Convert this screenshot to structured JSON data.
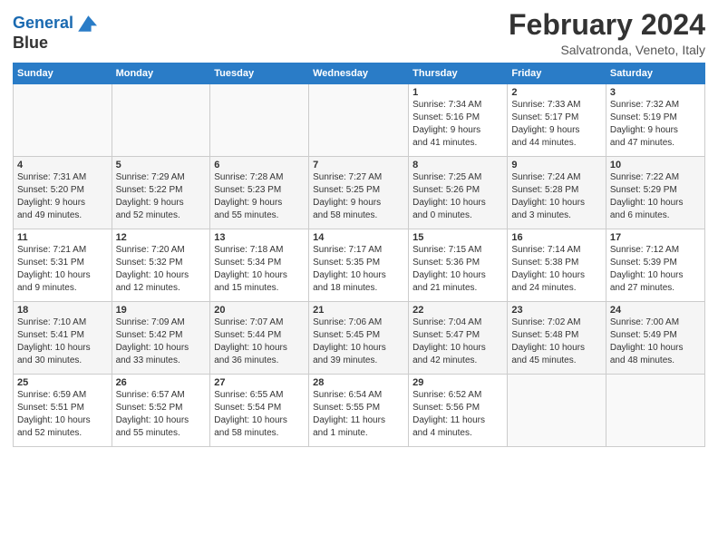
{
  "header": {
    "logo_line1": "General",
    "logo_line2": "Blue",
    "title": "February 2024",
    "subtitle": "Salvatronda, Veneto, Italy"
  },
  "weekdays": [
    "Sunday",
    "Monday",
    "Tuesday",
    "Wednesday",
    "Thursday",
    "Friday",
    "Saturday"
  ],
  "weeks": [
    [
      {
        "day": "",
        "info": ""
      },
      {
        "day": "",
        "info": ""
      },
      {
        "day": "",
        "info": ""
      },
      {
        "day": "",
        "info": ""
      },
      {
        "day": "1",
        "info": "Sunrise: 7:34 AM\nSunset: 5:16 PM\nDaylight: 9 hours\nand 41 minutes."
      },
      {
        "day": "2",
        "info": "Sunrise: 7:33 AM\nSunset: 5:17 PM\nDaylight: 9 hours\nand 44 minutes."
      },
      {
        "day": "3",
        "info": "Sunrise: 7:32 AM\nSunset: 5:19 PM\nDaylight: 9 hours\nand 47 minutes."
      }
    ],
    [
      {
        "day": "4",
        "info": "Sunrise: 7:31 AM\nSunset: 5:20 PM\nDaylight: 9 hours\nand 49 minutes."
      },
      {
        "day": "5",
        "info": "Sunrise: 7:29 AM\nSunset: 5:22 PM\nDaylight: 9 hours\nand 52 minutes."
      },
      {
        "day": "6",
        "info": "Sunrise: 7:28 AM\nSunset: 5:23 PM\nDaylight: 9 hours\nand 55 minutes."
      },
      {
        "day": "7",
        "info": "Sunrise: 7:27 AM\nSunset: 5:25 PM\nDaylight: 9 hours\nand 58 minutes."
      },
      {
        "day": "8",
        "info": "Sunrise: 7:25 AM\nSunset: 5:26 PM\nDaylight: 10 hours\nand 0 minutes."
      },
      {
        "day": "9",
        "info": "Sunrise: 7:24 AM\nSunset: 5:28 PM\nDaylight: 10 hours\nand 3 minutes."
      },
      {
        "day": "10",
        "info": "Sunrise: 7:22 AM\nSunset: 5:29 PM\nDaylight: 10 hours\nand 6 minutes."
      }
    ],
    [
      {
        "day": "11",
        "info": "Sunrise: 7:21 AM\nSunset: 5:31 PM\nDaylight: 10 hours\nand 9 minutes."
      },
      {
        "day": "12",
        "info": "Sunrise: 7:20 AM\nSunset: 5:32 PM\nDaylight: 10 hours\nand 12 minutes."
      },
      {
        "day": "13",
        "info": "Sunrise: 7:18 AM\nSunset: 5:34 PM\nDaylight: 10 hours\nand 15 minutes."
      },
      {
        "day": "14",
        "info": "Sunrise: 7:17 AM\nSunset: 5:35 PM\nDaylight: 10 hours\nand 18 minutes."
      },
      {
        "day": "15",
        "info": "Sunrise: 7:15 AM\nSunset: 5:36 PM\nDaylight: 10 hours\nand 21 minutes."
      },
      {
        "day": "16",
        "info": "Sunrise: 7:14 AM\nSunset: 5:38 PM\nDaylight: 10 hours\nand 24 minutes."
      },
      {
        "day": "17",
        "info": "Sunrise: 7:12 AM\nSunset: 5:39 PM\nDaylight: 10 hours\nand 27 minutes."
      }
    ],
    [
      {
        "day": "18",
        "info": "Sunrise: 7:10 AM\nSunset: 5:41 PM\nDaylight: 10 hours\nand 30 minutes."
      },
      {
        "day": "19",
        "info": "Sunrise: 7:09 AM\nSunset: 5:42 PM\nDaylight: 10 hours\nand 33 minutes."
      },
      {
        "day": "20",
        "info": "Sunrise: 7:07 AM\nSunset: 5:44 PM\nDaylight: 10 hours\nand 36 minutes."
      },
      {
        "day": "21",
        "info": "Sunrise: 7:06 AM\nSunset: 5:45 PM\nDaylight: 10 hours\nand 39 minutes."
      },
      {
        "day": "22",
        "info": "Sunrise: 7:04 AM\nSunset: 5:47 PM\nDaylight: 10 hours\nand 42 minutes."
      },
      {
        "day": "23",
        "info": "Sunrise: 7:02 AM\nSunset: 5:48 PM\nDaylight: 10 hours\nand 45 minutes."
      },
      {
        "day": "24",
        "info": "Sunrise: 7:00 AM\nSunset: 5:49 PM\nDaylight: 10 hours\nand 48 minutes."
      }
    ],
    [
      {
        "day": "25",
        "info": "Sunrise: 6:59 AM\nSunset: 5:51 PM\nDaylight: 10 hours\nand 52 minutes."
      },
      {
        "day": "26",
        "info": "Sunrise: 6:57 AM\nSunset: 5:52 PM\nDaylight: 10 hours\nand 55 minutes."
      },
      {
        "day": "27",
        "info": "Sunrise: 6:55 AM\nSunset: 5:54 PM\nDaylight: 10 hours\nand 58 minutes."
      },
      {
        "day": "28",
        "info": "Sunrise: 6:54 AM\nSunset: 5:55 PM\nDaylight: 11 hours\nand 1 minute."
      },
      {
        "day": "29",
        "info": "Sunrise: 6:52 AM\nSunset: 5:56 PM\nDaylight: 11 hours\nand 4 minutes."
      },
      {
        "day": "",
        "info": ""
      },
      {
        "day": "",
        "info": ""
      }
    ]
  ]
}
